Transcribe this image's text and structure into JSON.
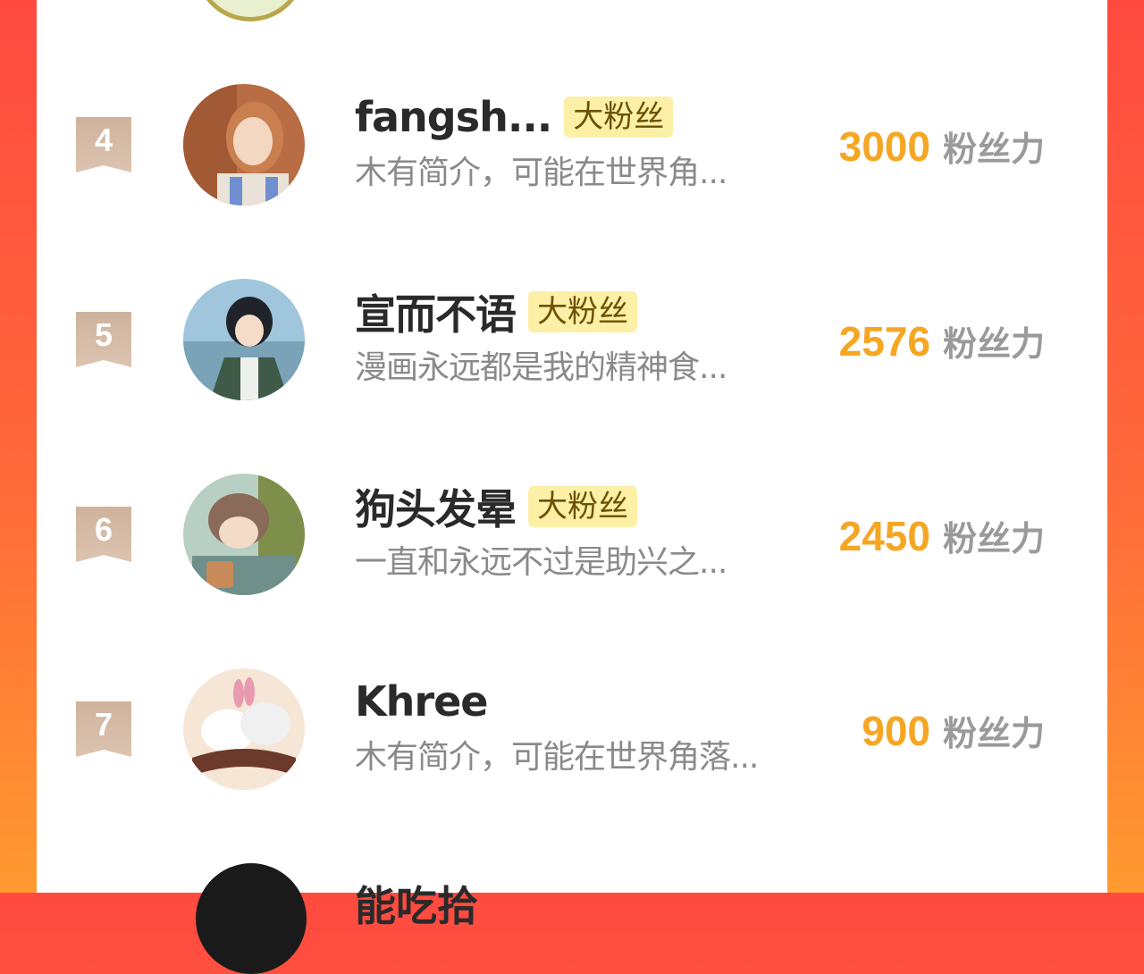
{
  "rows": [
    {
      "rank": "4",
      "name": "fangsh...",
      "badge": "大粉丝",
      "desc": "木有简介，可能在世界角...",
      "score": "3000",
      "unit": "粉丝力",
      "avatar_palette": [
        "#b86d45",
        "#f3d7c0",
        "#6f8fd0",
        "#e9e2d8"
      ]
    },
    {
      "rank": "5",
      "name": "宣而不语",
      "badge": "大粉丝",
      "desc": "漫画永远都是我的精神食...",
      "score": "2576",
      "unit": "粉丝力",
      "avatar_palette": [
        "#9fc6dc",
        "#20232a",
        "#f4dcc8",
        "#3f5b47"
      ]
    },
    {
      "rank": "6",
      "name": "狗头发晕",
      "badge": "大粉丝",
      "desc": "一直和永远不过是助兴之...",
      "score": "2450",
      "unit": "粉丝力",
      "avatar_palette": [
        "#7d8f4a",
        "#8a6a58",
        "#b8cfc4",
        "#c98a5a"
      ]
    },
    {
      "rank": "7",
      "name": "Khree",
      "badge": "",
      "desc": "木有简介，可能在世界角落...",
      "score": "900",
      "unit": "粉丝力",
      "avatar_palette": [
        "#f6e6d6",
        "#f0f0f0",
        "#6b3a2a",
        "#e89ab0"
      ]
    }
  ],
  "partial_bottom_name": "能吃拾",
  "colors": {
    "score": "#f5a623",
    "badge_bg": "#fcefa6",
    "rank_badge": "#c9a891",
    "frame_top": "#ff4a40",
    "frame_bottom": "#ff9a30"
  }
}
